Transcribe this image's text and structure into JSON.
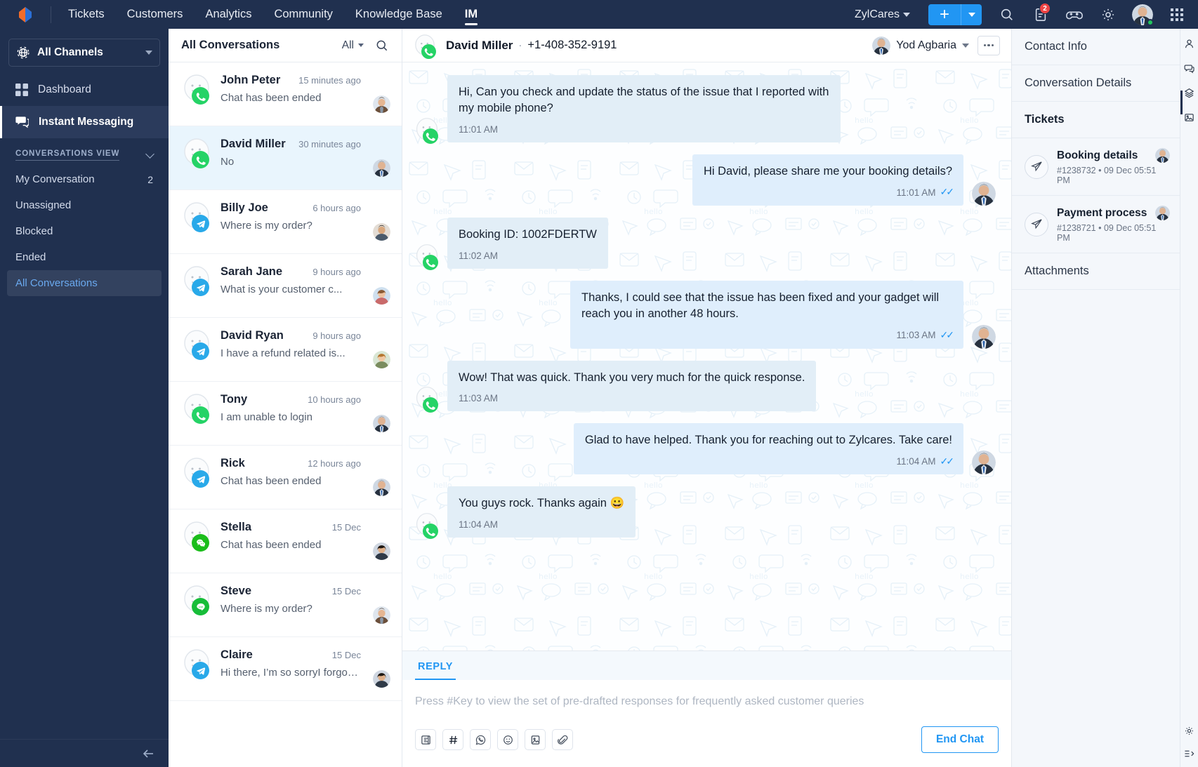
{
  "topbar": {
    "nav": [
      {
        "label": "Tickets",
        "active": false
      },
      {
        "label": "Customers",
        "active": false
      },
      {
        "label": "Analytics",
        "active": false
      },
      {
        "label": "Community",
        "active": false
      },
      {
        "label": "Knowledge Base",
        "active": false
      },
      {
        "label": "IM",
        "active": true
      }
    ],
    "org": "ZylCares",
    "add_label": "+",
    "icons": [
      "search-icon",
      "notes-icon",
      "gamification-icon",
      "gear-icon"
    ],
    "notes_badge": "2",
    "colors": {
      "bar": "#20304f",
      "accent": "#2196f3",
      "badge": "#ef4444"
    }
  },
  "sidebar": {
    "channel_selector": "All Channels",
    "items": [
      {
        "label": "Dashboard",
        "icon": "dashboard-icon",
        "active": false
      },
      {
        "label": "Instant Messaging",
        "icon": "chat-bubbles-icon",
        "active": true
      }
    ],
    "section_title": "CONVERSATIONS VIEW",
    "views": [
      {
        "label": "My Conversation",
        "count": "2",
        "selected": false
      },
      {
        "label": "Unassigned",
        "count": "",
        "selected": false
      },
      {
        "label": "Blocked",
        "count": "",
        "selected": false
      },
      {
        "label": "Ended",
        "count": "",
        "selected": false
      },
      {
        "label": "All Conversations",
        "count": "",
        "selected": true
      }
    ]
  },
  "conversation_list": {
    "title": "All Conversations",
    "filter": "All",
    "items": [
      {
        "name": "John Peter",
        "time": "15 minutes ago",
        "preview": "Chat has been ended",
        "channel": "whatsapp",
        "avatar": "male-1",
        "active": false
      },
      {
        "name": "David Miller",
        "time": "30 minutes ago",
        "preview": "No",
        "channel": "whatsapp",
        "avatar": "male-2",
        "active": true
      },
      {
        "name": "Billy Joe",
        "time": "6 hours ago",
        "preview": "Where is my order?",
        "channel": "telegram",
        "avatar": "male-3",
        "active": false
      },
      {
        "name": "Sarah Jane",
        "time": "9 hours ago",
        "preview": "What is your customer c...",
        "channel": "telegram",
        "avatar": "female-1",
        "active": false
      },
      {
        "name": "David Ryan",
        "time": "9 hours ago",
        "preview": "I have a refund related is...",
        "channel": "telegram",
        "avatar": "female-2",
        "active": false
      },
      {
        "name": "Tony",
        "time": "10 hours ago",
        "preview": "I am unable to login",
        "channel": "whatsapp",
        "avatar": "male-2",
        "active": false
      },
      {
        "name": "Rick",
        "time": "12 hours ago",
        "preview": "Chat has been ended",
        "channel": "telegram",
        "avatar": "male-2",
        "active": false
      },
      {
        "name": "Stella",
        "time": "15 Dec",
        "preview": "Chat has been ended",
        "channel": "wechat",
        "avatar": "female-3",
        "active": false
      },
      {
        "name": "Steve",
        "time": "15 Dec",
        "preview": "Where is my order?",
        "channel": "line",
        "avatar": "male-1",
        "active": false
      },
      {
        "name": "Claire",
        "time": "15 Dec",
        "preview": "Hi there, I’m so sorryI forgot ...",
        "channel": "telegram",
        "avatar": "female-3",
        "active": false
      }
    ]
  },
  "chat": {
    "contact_name": "David Miller",
    "separator": "·",
    "phone": "+1-408-352-9191",
    "channel": "whatsapp",
    "assignee": "Yod Agbaria",
    "messages": [
      {
        "dir": "in",
        "text": "Hi, Can you check and update the status of the issue that I reported with my mobile phone?",
        "time": "11:01 AM",
        "read": false
      },
      {
        "dir": "out",
        "text": "Hi David, please share me your booking details?",
        "time": "11:01 AM",
        "read": true
      },
      {
        "dir": "in",
        "text": "Booking ID: 1002FDERTW",
        "time": "11:02 AM",
        "read": false
      },
      {
        "dir": "out",
        "text": "Thanks, I could see that the issue has been fixed and your gadget will reach you in another 48 hours.",
        "time": "11:03 AM",
        "read": true
      },
      {
        "dir": "in",
        "text": "Wow! That was quick. Thank you very much for the quick response.",
        "time": "11:03 AM",
        "read": false
      },
      {
        "dir": "out",
        "text": "Glad to have helped. Thank you for reaching out to Zylcares. Take care!",
        "time": "11:04 AM",
        "read": true
      },
      {
        "dir": "in",
        "text": "You guys rock. Thanks again 😀",
        "time": "11:04 AM",
        "read": false
      }
    ]
  },
  "reply": {
    "tab": "REPLY",
    "placeholder": "Press #Key to view the set of pre-drafted responses for frequently asked customer queries",
    "tools": [
      "canned-response-icon",
      "hash-icon",
      "whatsapp-icon",
      "emoji-icon",
      "image-icon",
      "attachment-icon"
    ],
    "end_chat": "End Chat"
  },
  "right_panel": {
    "contact_info": "Contact Info",
    "conversation_details": "Conversation Details",
    "tickets_header": "Tickets",
    "tickets": [
      {
        "title": "Booking details",
        "id": "#1238732",
        "dot": "•",
        "date": "09 Dec 05:51 PM"
      },
      {
        "title": "Payment process",
        "id": "#1238721",
        "dot": "•",
        "date": "09 Dec 05:51 PM"
      }
    ],
    "attachments": "Attachments"
  },
  "right_rail": {
    "icons": [
      "contact-person-icon",
      "conversation-icon",
      "tickets-icon",
      "attachments-icon"
    ],
    "bottom_icons": [
      "gear-icon",
      "list-collapse-icon"
    ]
  }
}
